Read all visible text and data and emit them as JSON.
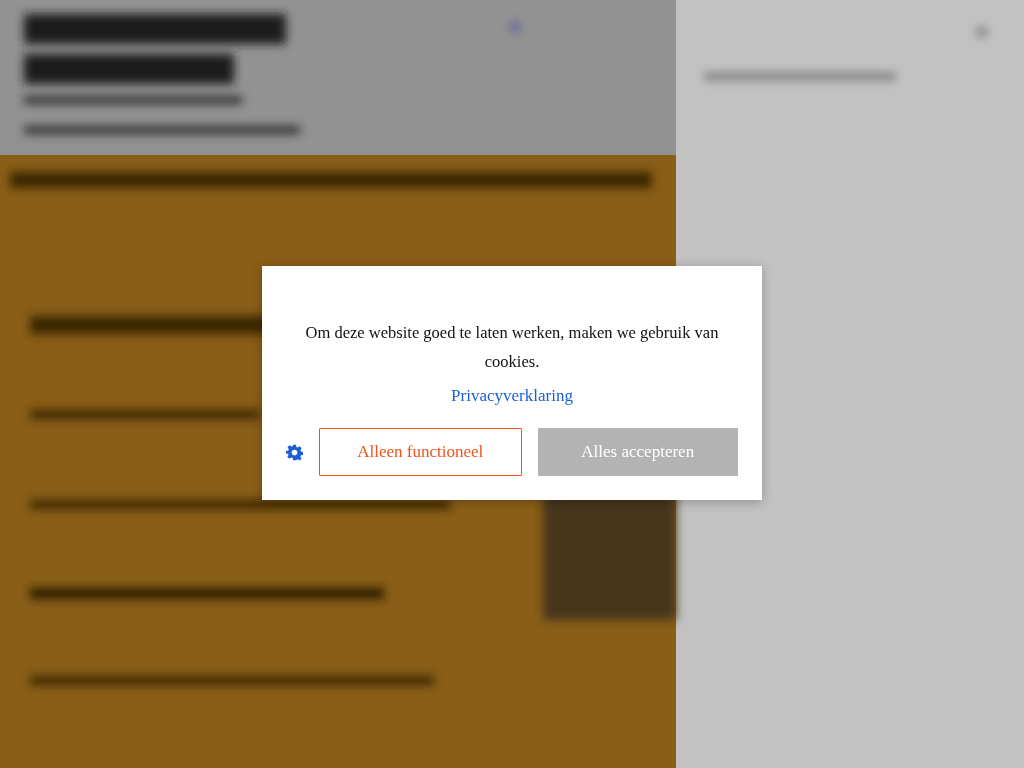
{
  "cookie_dialog": {
    "message": "Om deze website goed te laten werken, maken we gebruik van cookies.",
    "link": "Privacyverklaring",
    "buttons": [
      {
        "label": "Alleen functioneel",
        "kind": "outline"
      },
      {
        "label": "Alles accepteren",
        "kind": "filled"
      }
    ]
  }
}
